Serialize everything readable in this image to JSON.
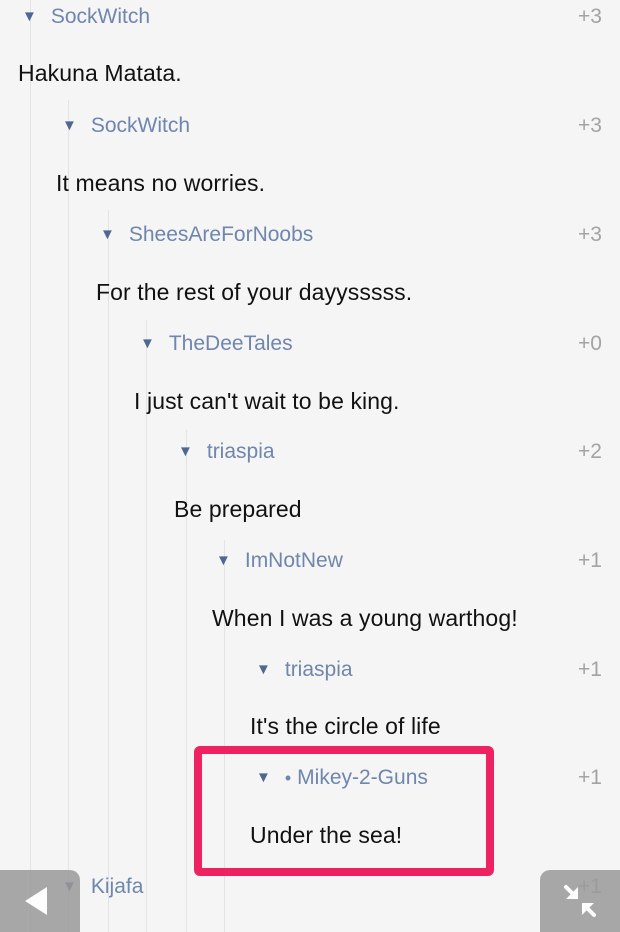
{
  "comments": [
    {
      "author": "SockWitch",
      "score": "+3",
      "text": "Hakuna Matata."
    },
    {
      "author": "SockWitch",
      "score": "+3",
      "text": "It means no worries."
    },
    {
      "author": "SheesAreForNoobs",
      "score": "+3",
      "text": "For the rest of your dayysssss."
    },
    {
      "author": "TheDeeTales",
      "score": "+0",
      "text": "I just can't wait to be king."
    },
    {
      "author": "triaspia",
      "score": "+2",
      "text": "Be prepared"
    },
    {
      "author": "ImNotNew",
      "score": "+1",
      "text": "When I was a young warthog!"
    },
    {
      "author": "triaspia",
      "score": "+1",
      "text": "It's the circle of life"
    },
    {
      "author": "Mikey-2-Guns",
      "score": "+1",
      "text": "Under the sea!",
      "bullet": "•"
    },
    {
      "author": "Kijafa",
      "score": "+1",
      "text": ""
    }
  ],
  "icons": {
    "collapse": "triangle-down-icon",
    "back": "back-arrow-icon",
    "minimize": "collapse-arrows-icon"
  },
  "colors": {
    "author": "#6f86ad",
    "score": "#a3a3a3",
    "highlight": "#ee2260"
  }
}
